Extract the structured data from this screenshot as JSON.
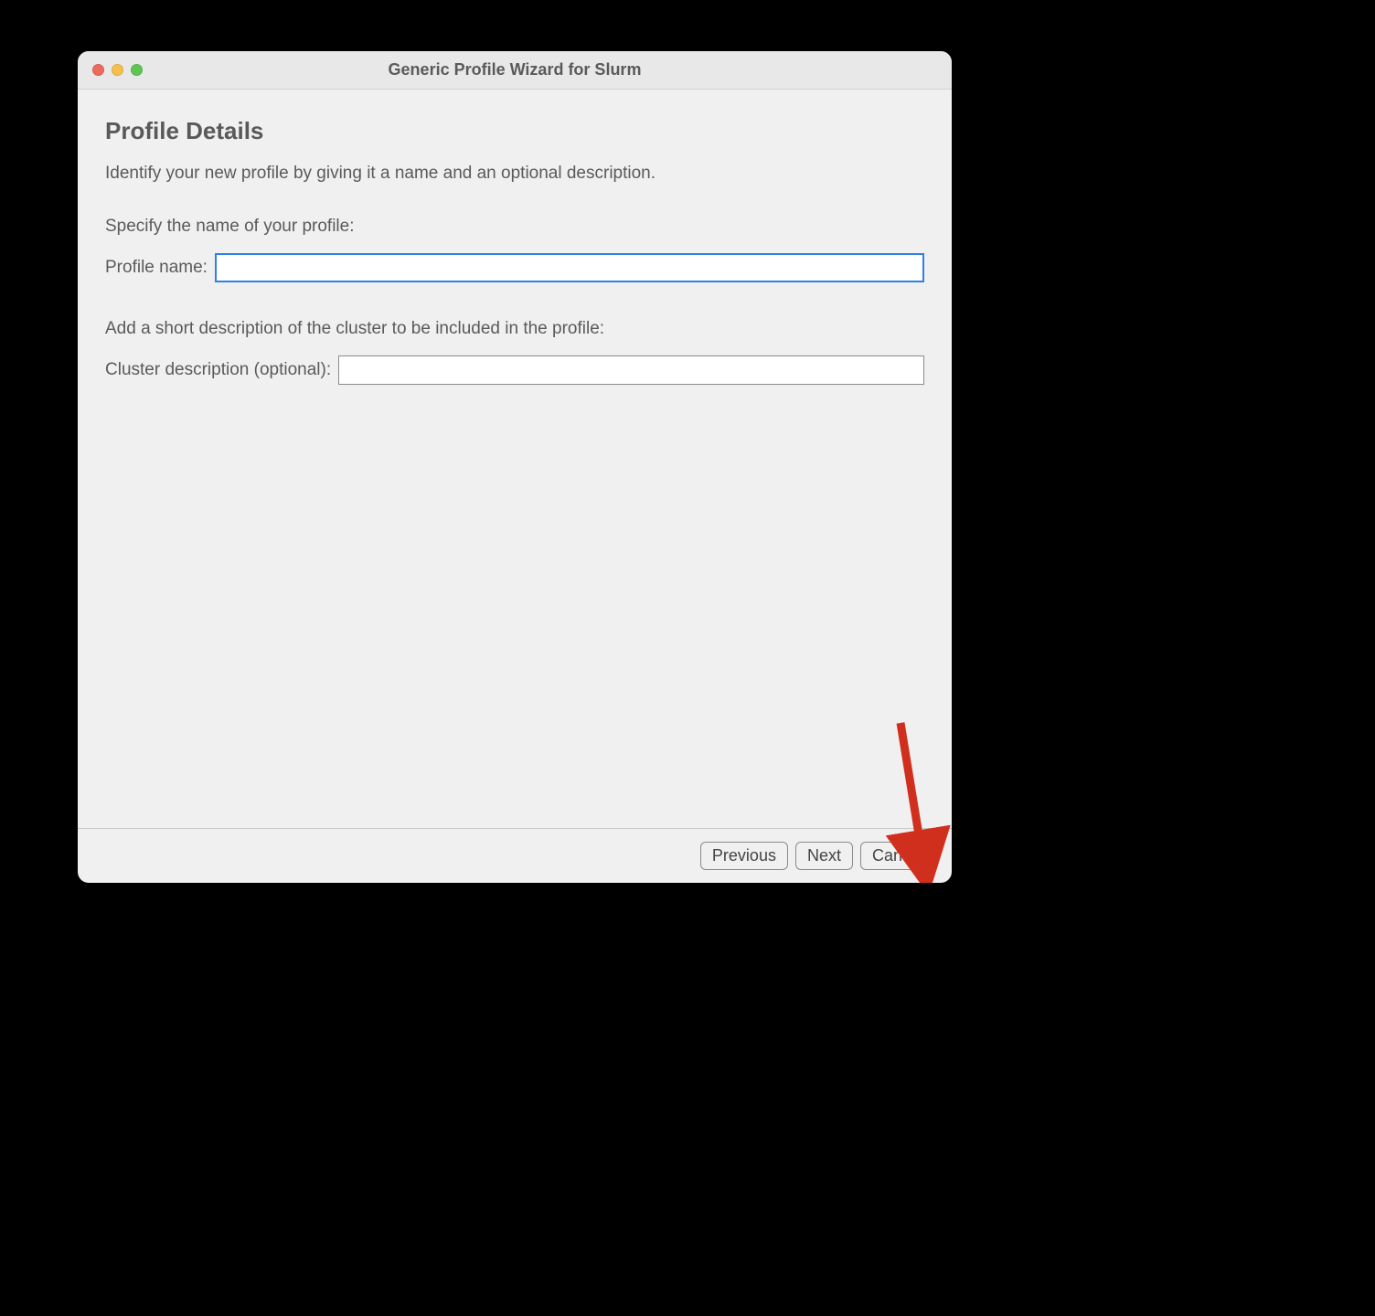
{
  "window": {
    "title": "Generic Profile Wizard for Slurm"
  },
  "page": {
    "heading": "Profile Details",
    "intro": "Identify your new profile by giving it a name and an optional description.",
    "name_section_label": "Specify the name of your profile:",
    "name_field_label": "Profile name:",
    "name_value": "",
    "desc_section_label": "Add a short description of the cluster to be included in the profile:",
    "desc_field_label": "Cluster description (optional):",
    "desc_value": ""
  },
  "buttons": {
    "previous": "Previous",
    "next": "Next",
    "cancel": "Cancel"
  }
}
